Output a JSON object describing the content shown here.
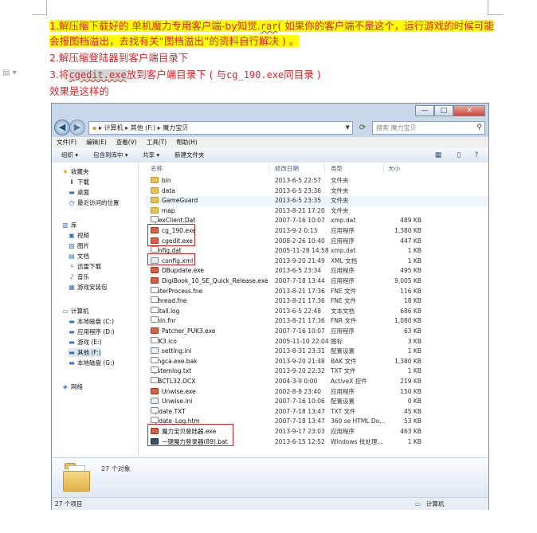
{
  "doc": {
    "line1_a": "1.解压缩下载好的 单机魔力专用客户端-by知觉.",
    "line1_ext": "rar",
    "line1_b": "( 如果你的客户端不是这个，运行游戏的时候可能",
    "line1_c": "会报图档溢出，去找有关“图档溢出”的资料自行解决 ) 。",
    "line2": "2.解压缩登陆器到客户端目录下",
    "line3_a": "3.将",
    "line3_file": "cgedit.exe",
    "line3_b": "放到客户端目录下 ( 与",
    "line3_file2": "cg_190.exe",
    "line3_c": "同目录 )",
    "line4": "效果是这样的"
  },
  "window": {
    "controls": {
      "minimize": "—",
      "maximize": "□",
      "close": "✕"
    },
    "address": {
      "seg1": "计算机",
      "seg2": "其他 (F:)",
      "seg3": "魔力宝贝",
      "sep": "▸"
    },
    "search_placeholder": "搜索 魔力宝贝",
    "menu": [
      "文件(F)",
      "编辑(E)",
      "查看(V)",
      "工具(T)",
      "帮助(H)"
    ],
    "toolbar": {
      "organize": "组织 ▾",
      "include": "包含到库中 ▾",
      "share": "共享 ▾",
      "newfolder": "新建文件夹"
    },
    "nav": {
      "favorites": "收藏夹",
      "downloads": "下载",
      "desktop": "桌面",
      "recent": "最近访问的位置",
      "libraries": "库",
      "videos": "视频",
      "pictures": "图片",
      "documents": "文档",
      "thunder": "迅雷下载",
      "music": "音乐",
      "games": "游戏安装包",
      "computer": "计算机",
      "drive_c": "本地磁盘 (C:)",
      "drive_d": "应用程序 (D:)",
      "drive_e": "游戏 (E:)",
      "drive_f": "其他 (F:)",
      "drive_g": "本地磁盘 (G:)",
      "network": "网络"
    },
    "columns": {
      "name": "名称",
      "date": "修改日期",
      "type": "类型",
      "size": "大小"
    },
    "files": [
      {
        "name": "bin",
        "date": "2013-6-5 22:57",
        "type": "文件夹",
        "size": ""
      },
      {
        "name": "data",
        "date": "2013-6-5 23:36",
        "type": "文件夹",
        "size": ""
      },
      {
        "name": "GameGuard",
        "date": "2013-6-5 23:35",
        "type": "文件夹",
        "size": ""
      },
      {
        "name": "map",
        "date": "2013-8-21 17:20",
        "type": "文件夹",
        "size": ""
      },
      {
        "name": "ApexClient.Dat",
        "date": "2007-7-16 10:07",
        "type": "xmp.dat",
        "size": "489 KB"
      },
      {
        "name": "cg_190.exe",
        "date": "2013-9-2 0:13",
        "type": "应用程序",
        "size": "1,380 KB"
      },
      {
        "name": "cgedit.exe",
        "date": "2008-2-26 10:40",
        "type": "应用程序",
        "size": "447 KB"
      },
      {
        "name": "Config.dat",
        "date": "2005-11-28 14:58",
        "type": "xmp.dat",
        "size": "1 KB"
      },
      {
        "name": "config.xml",
        "date": "2013-9-20 21:49",
        "type": "XML 文档",
        "size": "1 KB"
      },
      {
        "name": "DBupdate.exe",
        "date": "2013-6-5 23:34",
        "type": "应用程序",
        "size": "495 KB"
      },
      {
        "name": "DigiBook_10_SE_Quick_Release.exe",
        "date": "2007-7-18 13:44",
        "type": "应用程序",
        "size": "9,005 KB"
      },
      {
        "name": "EInterProcess.fne",
        "date": "2013-8-21 17:36",
        "type": "FNE 文件",
        "size": "116 KB"
      },
      {
        "name": "EThread.fne",
        "date": "2013-8-21 17:36",
        "type": "FNE 文件",
        "size": "18 KB"
      },
      {
        "name": "Install.log",
        "date": "2013-6-5 22:48",
        "type": "文本文档",
        "size": "686 KB"
      },
      {
        "name": "krnln.fnr",
        "date": "2013-8-21 17:36",
        "type": "FNR 文件",
        "size": "1,080 KB"
      },
      {
        "name": "Patcher_PUK3.exe",
        "date": "2007-7-16 10:07",
        "type": "应用程序",
        "size": "63 KB"
      },
      {
        "name": "PUK3.ico",
        "date": "2005-11-10 22:04",
        "type": "图标",
        "size": "3 KB"
      },
      {
        "name": "setting.ini",
        "date": "2013-8-31 23:31",
        "type": "配置设置",
        "size": "1 KB"
      },
      {
        "name": "songca.exe.bak",
        "date": "2013-9-20 21:48",
        "type": "BAK 文件",
        "size": "1,380 KB"
      },
      {
        "name": "systemlog.txt",
        "date": "2013-9-20 22:32",
        "type": "TXT 文件",
        "size": "1 KB"
      },
      {
        "name": "TABCTL32.OCX",
        "date": "2004-3-9 0:00",
        "type": "ActiveX 控件",
        "size": "219 KB"
      },
      {
        "name": "Unwise.exe",
        "date": "2002-8-8 23:40",
        "type": "应用程序",
        "size": "150 KB"
      },
      {
        "name": "Unwise.ini",
        "date": "2007-7-16 10:06",
        "type": "配置设置",
        "size": "0 KB"
      },
      {
        "name": "Update.TXT",
        "date": "2007-7-18 13:47",
        "type": "TXT 文件",
        "size": "45 KB"
      },
      {
        "name": "Update_Log.htm",
        "date": "2007-7-18 13:47",
        "type": "360 se HTML Do...",
        "size": "53 KB"
      },
      {
        "name": "魔力宝贝登陆器.exe",
        "date": "2013-9-17 23:03",
        "type": "应用程序",
        "size": "463 KB"
      },
      {
        "name": "一键魔力登录器(89).bat",
        "date": "2013-6-15 12:52",
        "type": "Windows 批处理...",
        "size": "1 KB"
      }
    ],
    "details_count": "27 个对象",
    "status_count": "27 个项目",
    "status_computer": "计算机"
  }
}
